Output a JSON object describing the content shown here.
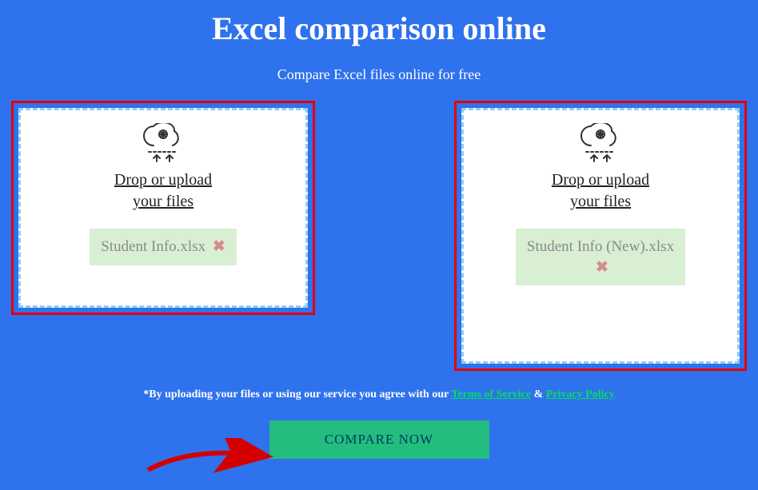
{
  "header": {
    "title": "Excel comparison online",
    "subtitle": "Compare Excel files online for free"
  },
  "drop": {
    "label_line1": "Drop or upload",
    "label_line2": "your files",
    "left_file": "Student Info.xlsx",
    "right_file": "Student Info (New).xlsx",
    "remove_glyph": "✖"
  },
  "disclaimer": {
    "prefix": "*By uploading your files or using our service you agree with our ",
    "tos": "Terms of Service",
    "amp": " & ",
    "privacy": "Privacy Policy"
  },
  "compare_label": "COMPARE NOW"
}
